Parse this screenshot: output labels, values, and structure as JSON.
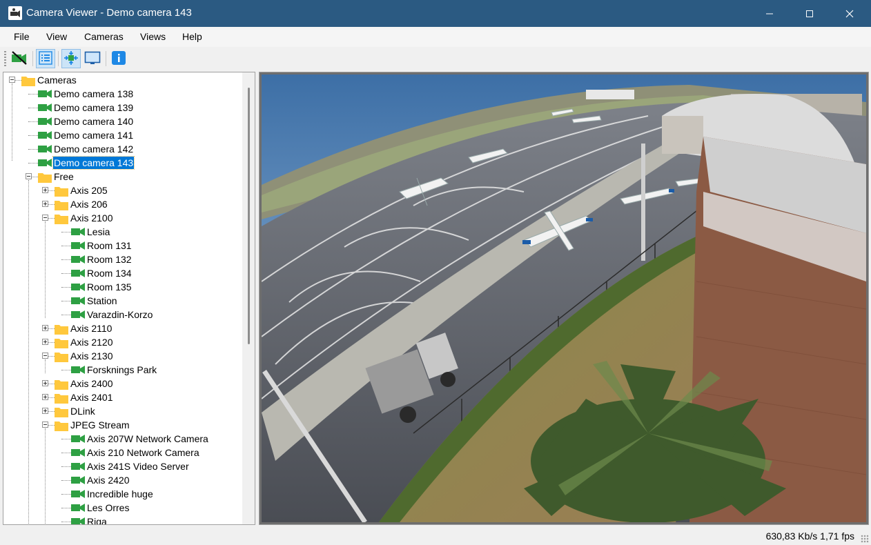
{
  "window": {
    "title": "Camera Viewer - Demo camera 143"
  },
  "menu": [
    "File",
    "View",
    "Cameras",
    "Views",
    "Help"
  ],
  "toolbar": {
    "buttons": [
      "camera-off-icon",
      "camera-list-icon",
      "fit-to-window-icon",
      "fullscreen-icon",
      "info-icon"
    ],
    "accent_color": "#1e88e5"
  },
  "tree": {
    "root": "Cameras",
    "demo_cameras": [
      "Demo camera 138",
      "Demo camera 139",
      "Demo camera 140",
      "Demo camera 141",
      "Demo camera 142",
      "Demo camera 143"
    ],
    "selected": "Demo camera 143",
    "free": "Free",
    "axis205": "Axis 205",
    "axis206": "Axis 206",
    "axis2100": "Axis 2100",
    "axis2100_children": [
      "Lesia",
      "Room 131",
      "Room 132",
      "Room 134",
      "Room 135",
      "Station",
      "Varazdin-Korzo"
    ],
    "axis2110": "Axis 2110",
    "axis2120": "Axis 2120",
    "axis2130": "Axis 2130",
    "axis2130_children": [
      "Forsknings Park"
    ],
    "axis2400": "Axis 2400",
    "axis2401": "Axis 2401",
    "dlink": "DLink",
    "jpeg": "JPEG Stream",
    "jpeg_children": [
      "Axis 207W Network Camera",
      "Axis 210  Network Camera",
      "Axis 241S Video Server",
      "Axis 2420",
      "Incredible huge",
      "Les Orres",
      "Riga"
    ],
    "folder_color": "#ffc83d",
    "camera_color": "#2ea043"
  },
  "status": {
    "text": "630,83 Kb/s  1,71 fps"
  }
}
